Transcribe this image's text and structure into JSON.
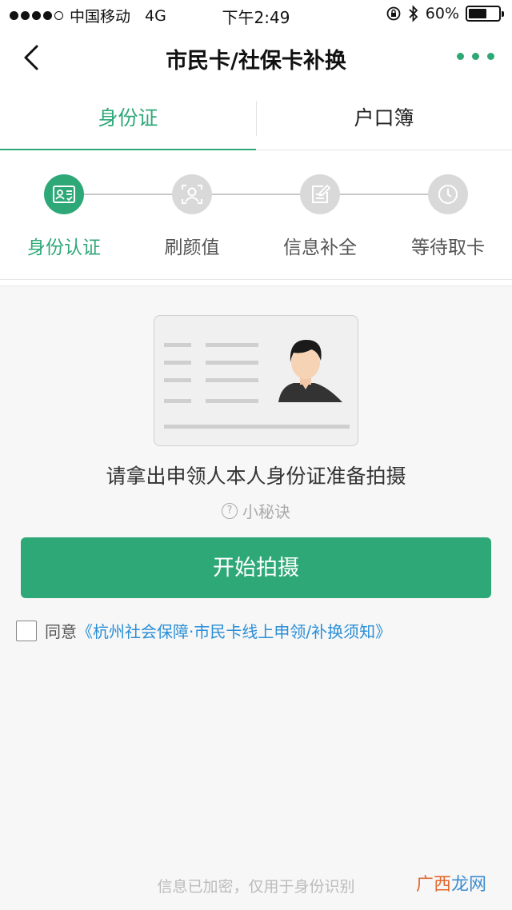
{
  "status_bar": {
    "carrier": "中国移动",
    "network": "4G",
    "time": "下午2:49",
    "battery": "60%",
    "battery_level": 0.6
  },
  "nav": {
    "title": "市民卡/社保卡补换"
  },
  "tabs": [
    {
      "label": "身份证",
      "active": true
    },
    {
      "label": "户口簿",
      "active": false
    }
  ],
  "steps": [
    {
      "label": "身份认证",
      "icon": "id-card-icon",
      "active": true
    },
    {
      "label": "刷颜值",
      "icon": "face-scan-icon",
      "active": false
    },
    {
      "label": "信息补全",
      "icon": "edit-form-icon",
      "active": false
    },
    {
      "label": "等待取卡",
      "icon": "clock-icon",
      "active": false
    }
  ],
  "main": {
    "instruction": "请拿出申领人本人身份证准备拍摄",
    "tips_icon_glyph": "?",
    "tips_label": "小秘诀",
    "start_button": "开始拍摄",
    "agree_prefix": "同意",
    "agree_link": "《杭州社会保障·市民卡线上申领/补换须知》",
    "footer_note": "信息已加密，仅用于身份识别"
  },
  "watermark": {
    "part1": "广西",
    "part2": "龙网"
  },
  "colors": {
    "accent": "#2fa878",
    "link": "#2b8fd6"
  }
}
